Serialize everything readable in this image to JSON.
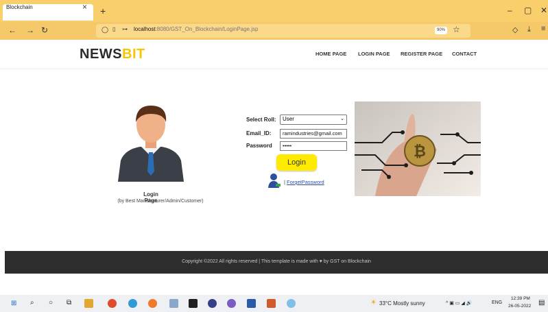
{
  "browser": {
    "tab_title": "Blockchain",
    "tab_close": "×",
    "new_tab": "+",
    "window_controls": [
      "–",
      "▢",
      "✕"
    ],
    "url_host": "localhost",
    "url_rest": ":8080/GST_On_Blockchain/LoginPage.jsp",
    "zoom": "90%"
  },
  "site": {
    "logo_part1": "NEWS",
    "logo_part2": "BIT",
    "menu": [
      "HOME PAGE",
      "LOGIN PAGE",
      "REGISTER PAGE",
      "CONTACT"
    ]
  },
  "login_panel": {
    "caption": "Login Page",
    "subcaption": "(by Best Manufacturer/Admin/Customer)"
  },
  "form": {
    "role_label": "Select Roll:",
    "role_value": "User",
    "email_label": "Email_ID:",
    "email_value": "ramindustries@gmail.com",
    "password_label": "Password",
    "password_value": "•••••",
    "login_button": "Login",
    "forget_prefix": "| ",
    "forget_link": "ForgetPassword"
  },
  "footer": {
    "text": "Copyright ©2022 All rights reserved | This template is made with ♥ by GST on Blockchain"
  },
  "taskbar": {
    "weather": "33°C  Mostly sunny",
    "lang": "ENG",
    "time": "12:39 PM",
    "date": "26-05-2022"
  },
  "colors": {
    "browser_bar": "#f9cf6c",
    "logo_accent": "#f7c600",
    "button": "#ffeb00",
    "footer": "#2d2d2d"
  }
}
